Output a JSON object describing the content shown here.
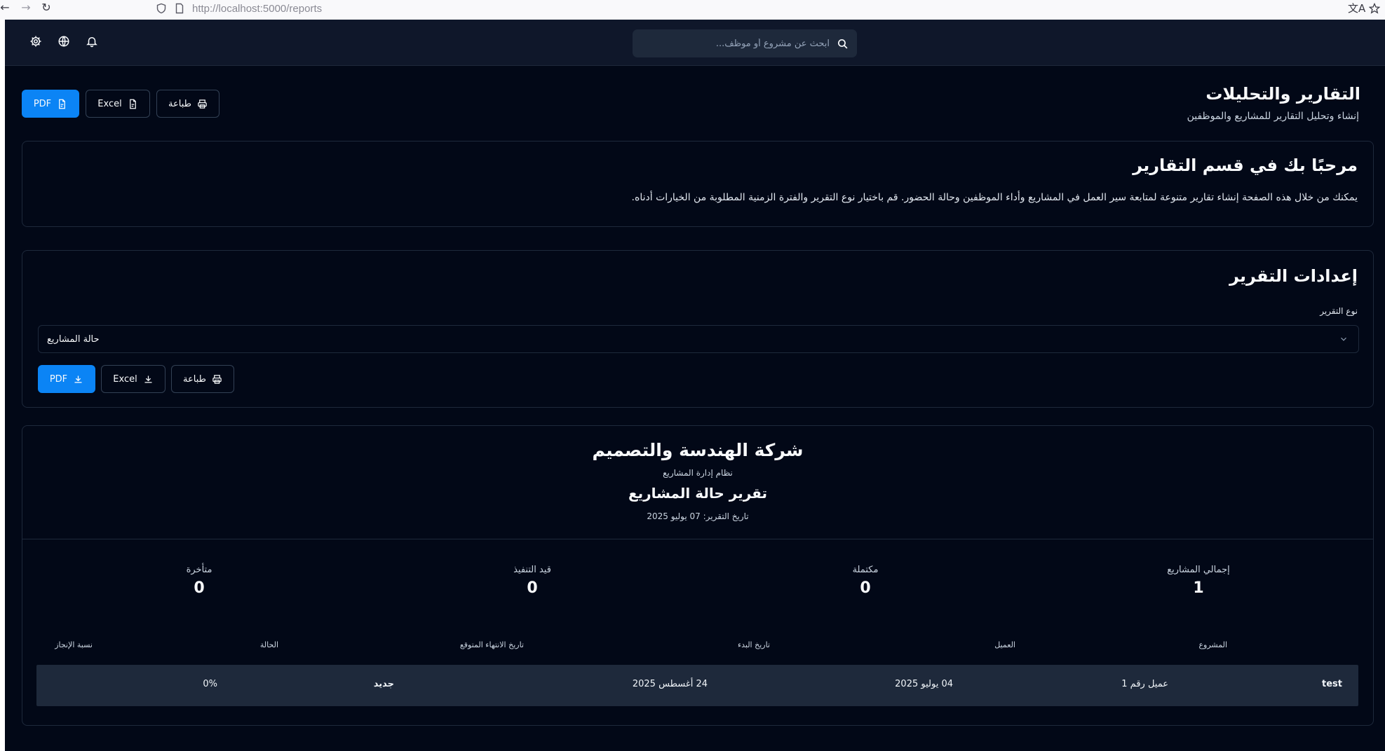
{
  "browser": {
    "url": "http://localhost:5000/reports"
  },
  "search": {
    "placeholder": "ابحث عن مشروع أو موظف..."
  },
  "header": {
    "title": "التقارير والتحليلات",
    "subtitle": "إنشاء وتحليل التقارير للمشاريع والموظفين",
    "actions": {
      "pdf": "PDF",
      "excel": "Excel",
      "print": "طباعة"
    }
  },
  "welcome": {
    "title": "مرحبًا بك في قسم التقارير",
    "text": "يمكنك من خلال هذه الصفحة إنشاء تقارير متنوعة لمتابعة سير العمل في المشاريع وأداء الموظفين وحالة الحضور. قم باختيار نوع التقرير والفترة الزمنية المطلوبة من الخيارات أدناه."
  },
  "settings": {
    "title": "إعدادات التقرير",
    "report_type_label": "نوع التقرير",
    "report_type_value": "حالة المشاريع",
    "actions": {
      "pdf": "PDF",
      "excel": "Excel",
      "print": "طباعة"
    }
  },
  "report": {
    "company": "شركة الهندسة والتصميم",
    "system": "نظام إدارة المشاريع",
    "title": "تقرير حالة المشاريع",
    "date": "تاريخ التقرير: 07 يوليو 2025",
    "stats": [
      {
        "label": "إجمالي المشاريع",
        "value": "1"
      },
      {
        "label": "مكتملة",
        "value": "0"
      },
      {
        "label": "قيد التنفيذ",
        "value": "0"
      },
      {
        "label": "متأخرة",
        "value": "0"
      }
    ],
    "table": {
      "headers": [
        "المشروع",
        "العميل",
        "تاريخ البدء",
        "تاريخ الانتهاء المتوقع",
        "الحالة",
        "نسبة الإنجاز"
      ],
      "rows": [
        [
          "test",
          "عميل رقم 1",
          "04 يوليو 2025",
          "24 أغسطس 2025",
          "جديد",
          "0%"
        ]
      ]
    }
  }
}
